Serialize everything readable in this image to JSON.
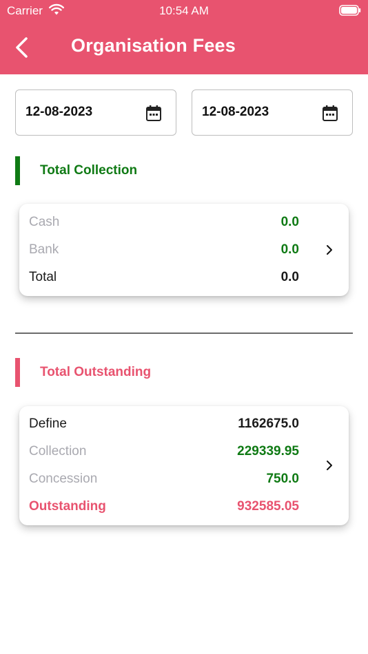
{
  "status_bar": {
    "carrier": "Carrier",
    "time": "10:54 AM"
  },
  "header": {
    "title": "Organisation Fees",
    "back_icon": "chevron-left-icon"
  },
  "filters": {
    "from_date": "12-08-2023",
    "to_date": "12-08-2023",
    "date_icon": "calendar-icon"
  },
  "collection": {
    "title": "Total Collection",
    "rows": [
      {
        "label": "Cash",
        "value": "0.0"
      },
      {
        "label": "Bank",
        "value": "0.0"
      },
      {
        "label": "Total",
        "value": "0.0"
      }
    ]
  },
  "outstanding": {
    "title": "Total Outstanding",
    "rows": [
      {
        "label": "Define",
        "value": "1162675.0"
      },
      {
        "label": "Collection",
        "value": "229339.95"
      },
      {
        "label": "Concession",
        "value": "750.0"
      },
      {
        "label": "Outstanding",
        "value": "932585.05"
      }
    ]
  },
  "colors": {
    "brand": "#e8536f",
    "positive": "#0f7a14",
    "muted": "#a9a9b0"
  }
}
